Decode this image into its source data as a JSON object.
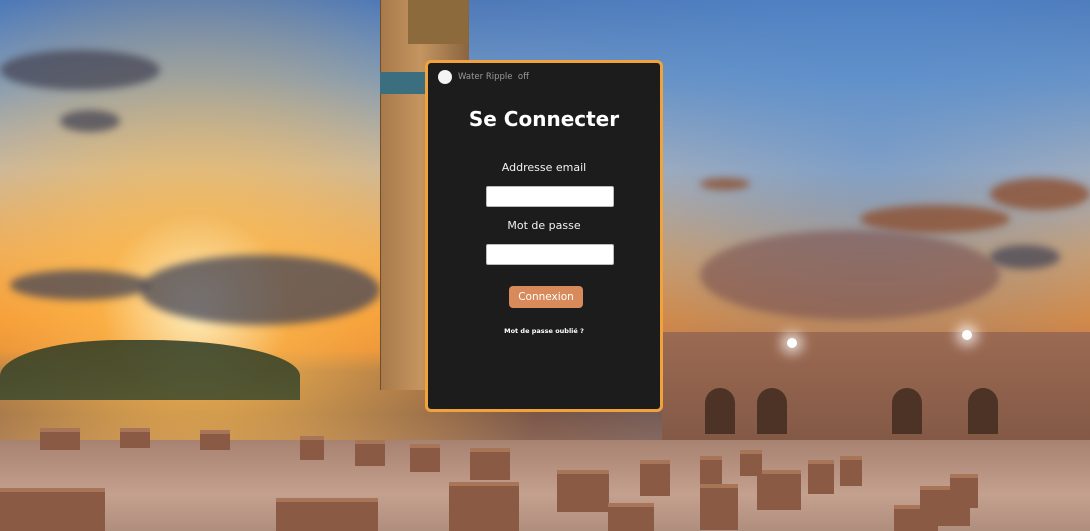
{
  "background": {
    "description_icon": "marrakech-koutoubia-sunset-image",
    "accent_color": "#f0a33c"
  },
  "toggle": {
    "label": "Water Ripple  off"
  },
  "login": {
    "title": "Se Connecter",
    "email_label": "Addresse email",
    "email_value": "",
    "password_label": "Mot de passe",
    "password_value": "",
    "submit_label": "Connexion",
    "forgot_label": "Mot de passe oublié ?",
    "button_color": "#d88a5a",
    "card_color": "#1c1c1c"
  }
}
